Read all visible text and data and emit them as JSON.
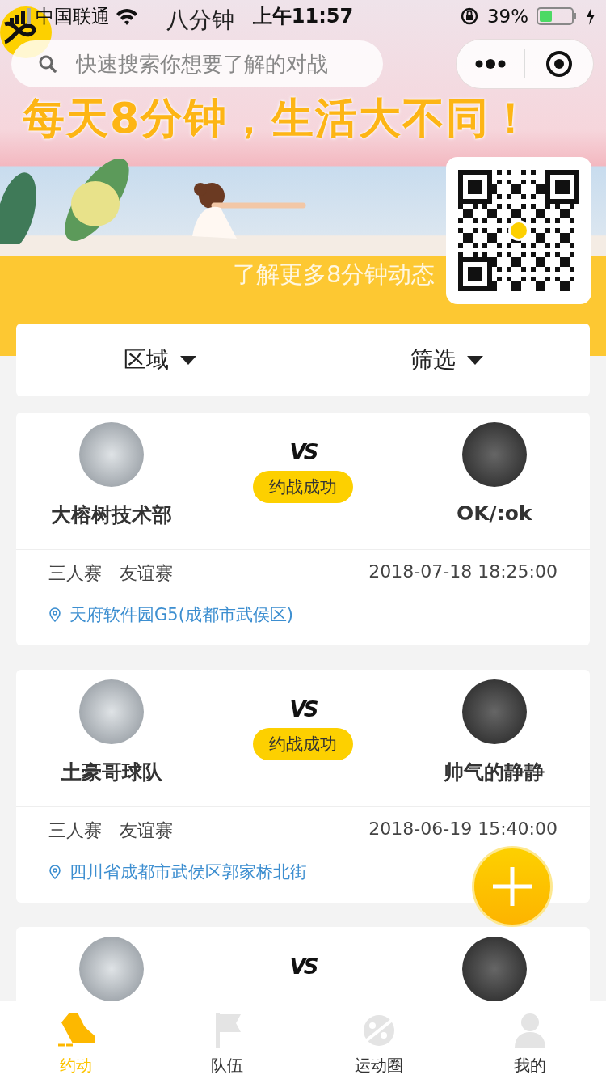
{
  "status_bar": {
    "carrier": "中国联通",
    "time": "上午11:57",
    "battery": "39%"
  },
  "header": {
    "logo_text": "八分钟",
    "search": {
      "placeholder": "快速搜索你想要了解的对战"
    }
  },
  "banner": {
    "slogan": "每天8分钟，生活大不同！",
    "caption": "了解更多8分钟动态"
  },
  "filters": [
    {
      "label": "区域"
    },
    {
      "label": "筛选"
    }
  ],
  "matches": [
    {
      "home": "大榕树技术部",
      "away": "OK/:ok",
      "vs": "VS",
      "status": "约战成功",
      "format": "三人赛",
      "mode": "友谊赛",
      "time": "2018-07-18 18:25:00",
      "location": "天府软件园G5(成都市武侯区)"
    },
    {
      "home": "土豪哥球队",
      "away": "帅气的静静",
      "vs": "VS",
      "status": "约战成功",
      "format": "三人赛",
      "mode": "友谊赛",
      "time": "2018-06-19 15:40:00",
      "location": "四川省成都市武侯区郭家桥北街"
    },
    {
      "vs": "VS"
    }
  ],
  "tabs": [
    {
      "label": "约动",
      "selected": true
    },
    {
      "label": "队伍",
      "selected": false
    },
    {
      "label": "运动圈",
      "selected": false
    },
    {
      "label": "我的",
      "selected": false
    }
  ]
}
